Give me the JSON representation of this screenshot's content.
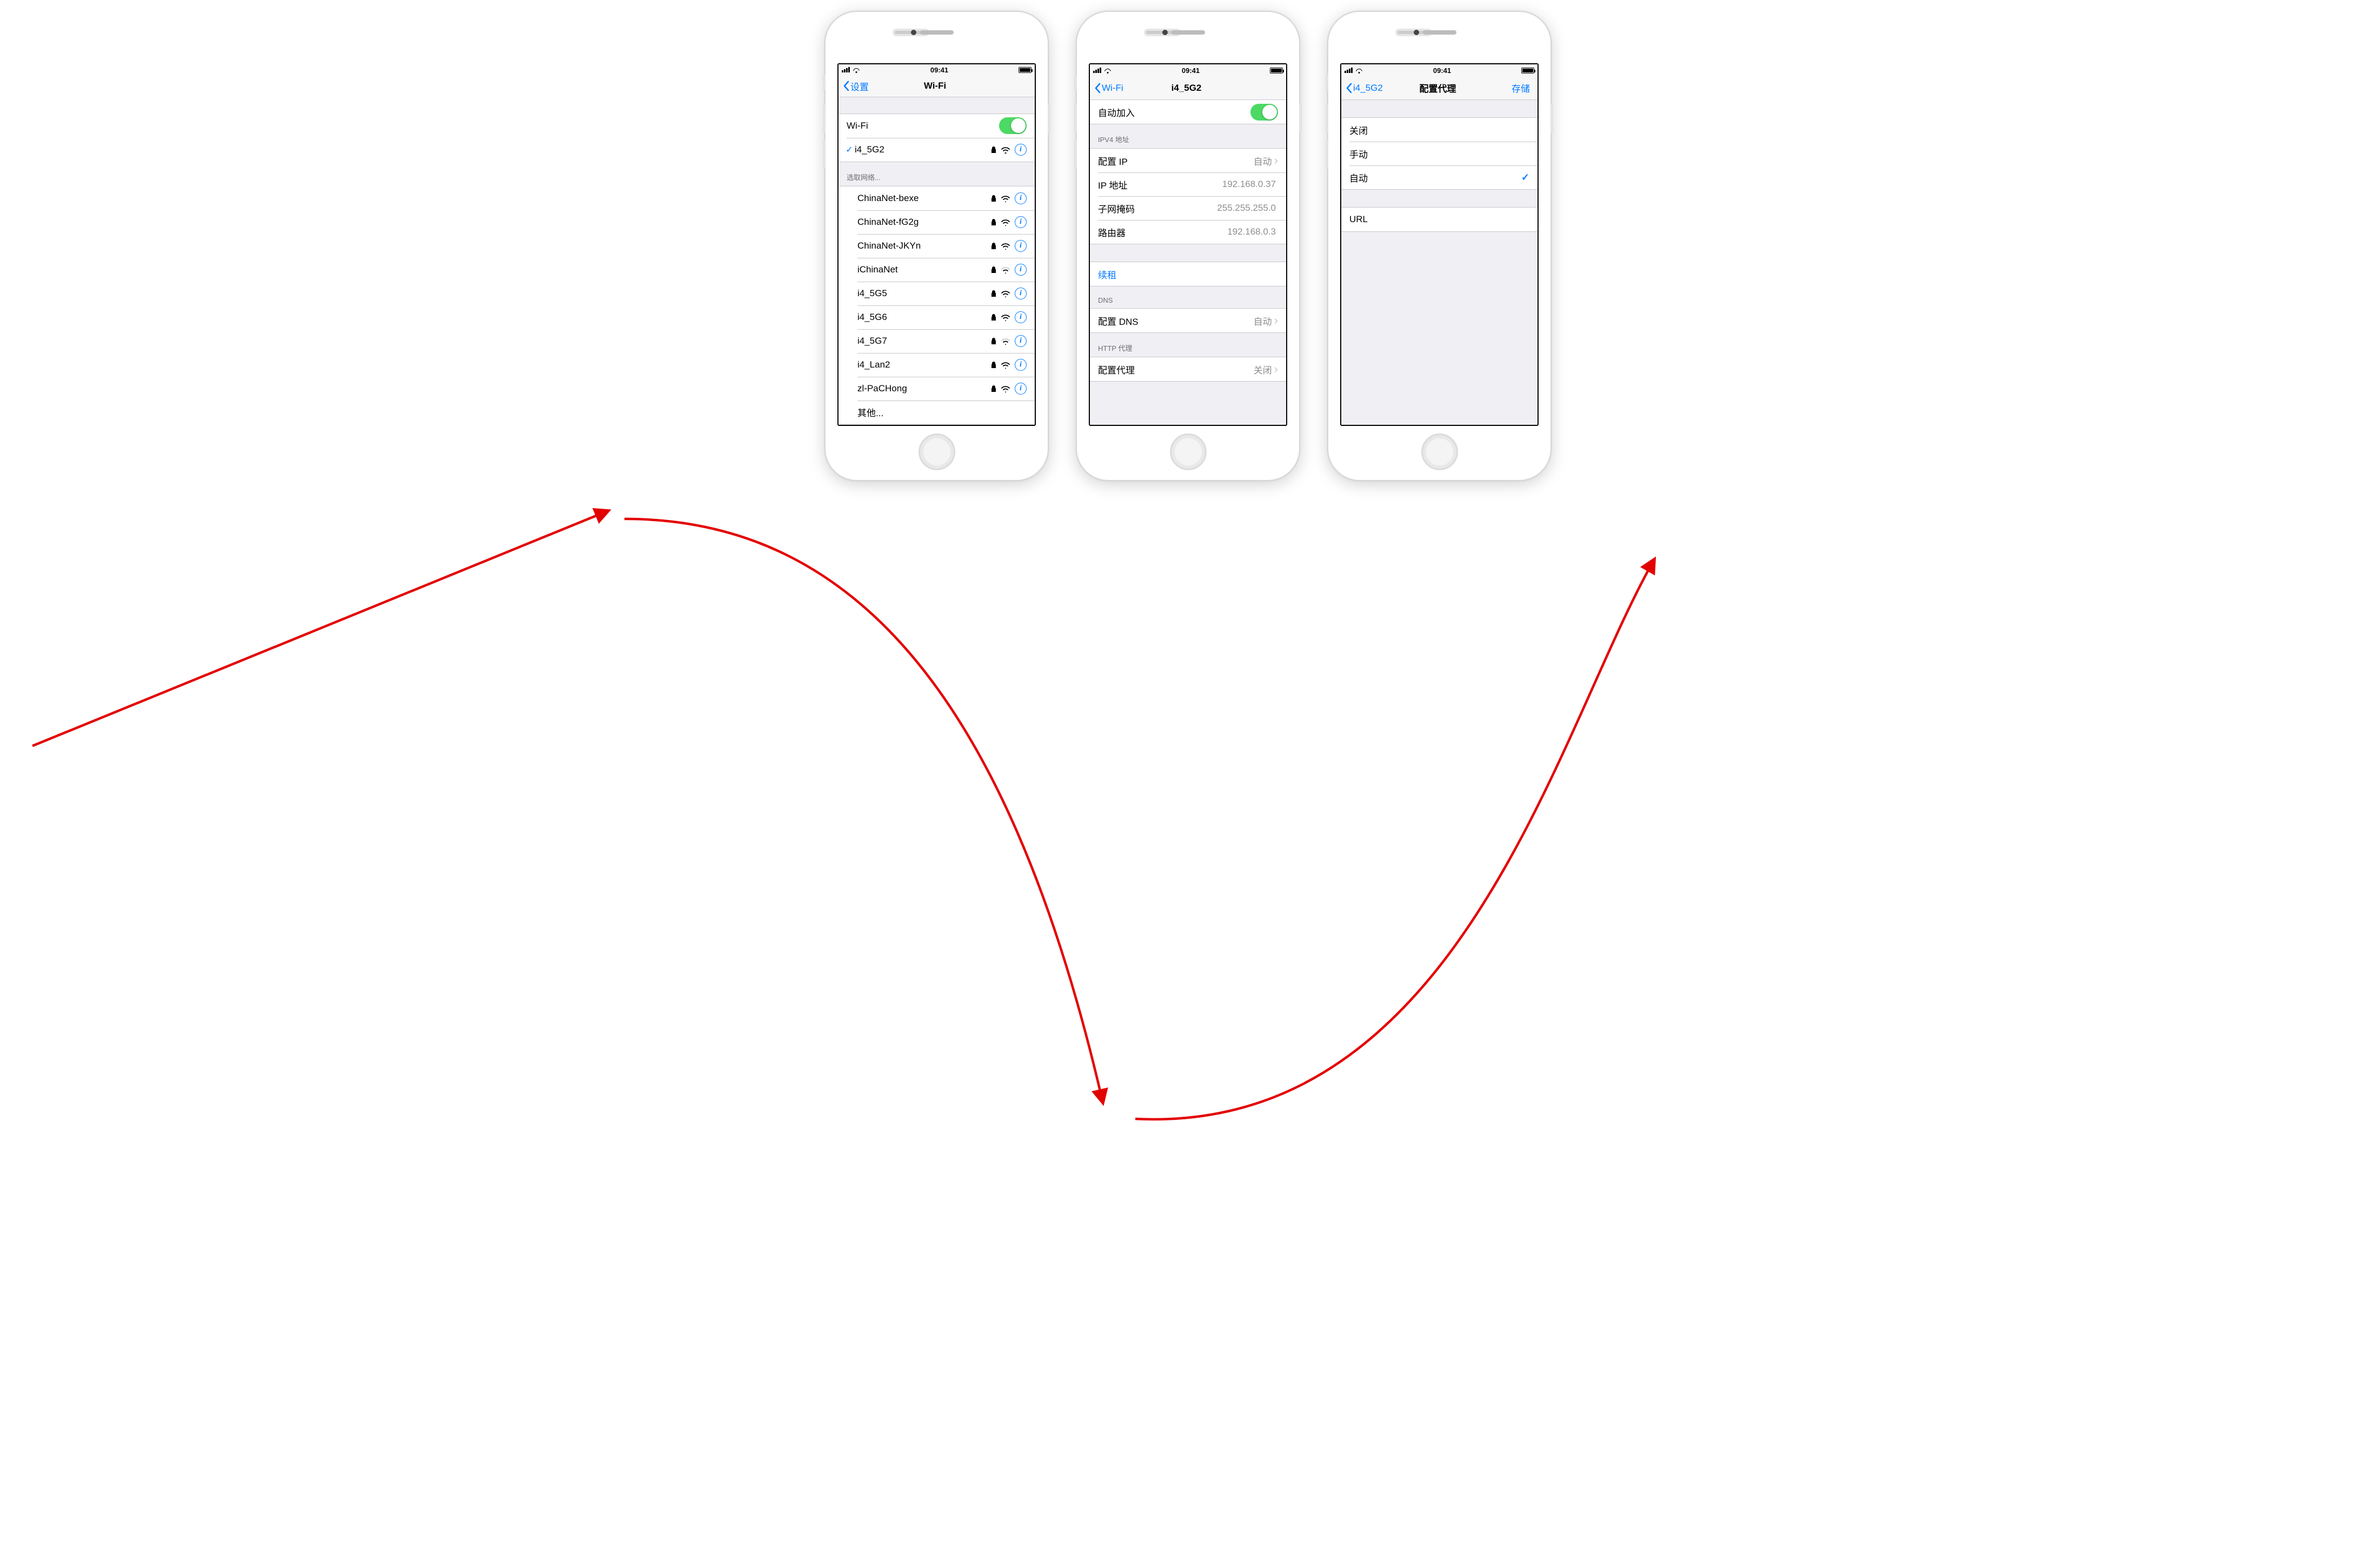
{
  "status": {
    "time": "09:41"
  },
  "screen1": {
    "back": "设置",
    "title": "Wi-Fi",
    "wifi_label": "Wi-Fi",
    "connected": "i4_5G2",
    "choose_header": "选取网络...",
    "networks": [
      {
        "name": "ChinaNet-bexe",
        "locked": true,
        "bars": 3
      },
      {
        "name": "ChinaNet-fG2g",
        "locked": true,
        "bars": 3
      },
      {
        "name": "ChinaNet-JKYn",
        "locked": true,
        "bars": 3
      },
      {
        "name": "iChinaNet",
        "locked": true,
        "bars": 2
      },
      {
        "name": "i4_5G5",
        "locked": true,
        "bars": 3
      },
      {
        "name": "i4_5G6",
        "locked": true,
        "bars": 3
      },
      {
        "name": "i4_5G7",
        "locked": true,
        "bars": 2
      },
      {
        "name": "i4_Lan2",
        "locked": true,
        "bars": 3
      },
      {
        "name": "zl-PaCHong",
        "locked": true,
        "bars": 3
      }
    ],
    "other": "其他..."
  },
  "screen2": {
    "back": "Wi-Fi",
    "title": "i4_5G2",
    "auto_join": "自动加入",
    "ipv4_header": "IPV4 地址",
    "config_ip": {
      "label": "配置 IP",
      "value": "自动"
    },
    "ip": {
      "label": "IP 地址",
      "value": "192.168.0.37"
    },
    "mask": {
      "label": "子网掩码",
      "value": "255.255.255.0"
    },
    "router": {
      "label": "路由器",
      "value": "192.168.0.3"
    },
    "renew": "续租",
    "dns_header": "DNS",
    "config_dns": {
      "label": "配置 DNS",
      "value": "自动"
    },
    "proxy_header": "HTTP 代理",
    "config_proxy": {
      "label": "配置代理",
      "value": "关闭"
    }
  },
  "screen3": {
    "back": "i4_5G2",
    "title": "配置代理",
    "save": "存储",
    "off": "关闭",
    "manual": "手动",
    "auto": "自动",
    "selected": "auto",
    "url_label": "URL"
  }
}
